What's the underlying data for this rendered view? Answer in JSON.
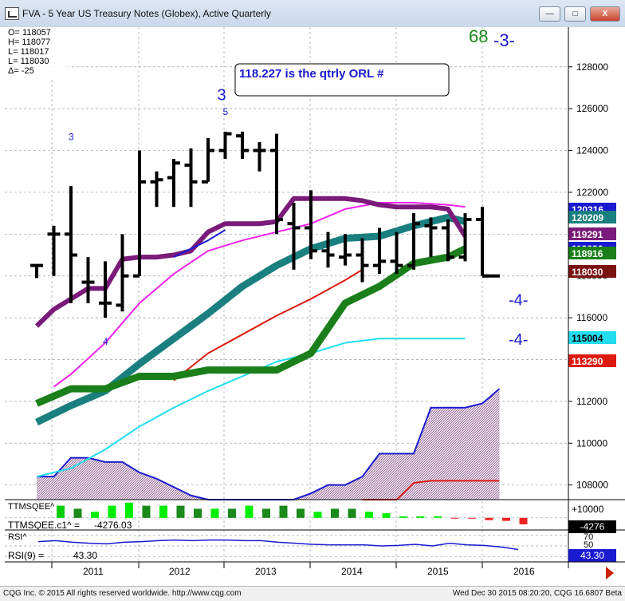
{
  "window": {
    "title": "FVA - 5 Year US Treasury Notes (Globex), Active Quarterly",
    "minimize_label": "—",
    "maximize_label": "□",
    "close_label": "X"
  },
  "status_bar": {
    "copyright": "CQG Inc. © 2015 All rights reserved worldwide. http://www.cqg.com",
    "timestamp": "Wed Dec 30 2015 08:20:20, CQG 16.6807 Beta"
  },
  "chart_data": [
    {
      "type": "ohlc",
      "panel": "price",
      "info_box": [
        "O= 118057",
        "H= 118077",
        "L= 118017",
        "L= 118030",
        "Δ=   -25"
      ],
      "annotation_box": "118.227 is the qtrly ORL #",
      "corner_labels": {
        "green": "68",
        "blue": "-3-"
      },
      "x_labels": [
        "2011",
        "2012",
        "2013",
        "2014",
        "2015",
        "2016"
      ],
      "y_ticks": [
        "128000",
        "126000",
        "124000",
        "122000",
        "120000",
        "118000",
        "116000",
        "114000",
        "112000",
        "110000",
        "108000"
      ],
      "ylim": [
        107300,
        129900
      ],
      "bars": [
        {
          "t": 0,
          "o": 118500,
          "h": 118500,
          "l": 117900,
          "c": 118500
        },
        {
          "t": 1,
          "o": 120000,
          "h": 120400,
          "l": 118000,
          "c": 120000
        },
        {
          "t": 2,
          "o": 120000,
          "h": 122300,
          "l": 116700,
          "c": 119000
        },
        {
          "t": 3,
          "o": 117700,
          "h": 118900,
          "l": 116700,
          "c": 117700
        },
        {
          "t": 4,
          "o": 116700,
          "h": 118700,
          "l": 116000,
          "c": 116700
        },
        {
          "t": 5,
          "o": 116600,
          "h": 120000,
          "l": 116300,
          "c": 118000
        },
        {
          "t": 6,
          "o": 118000,
          "h": 124000,
          "l": 118000,
          "c": 122500
        },
        {
          "t": 7,
          "o": 122500,
          "h": 123000,
          "l": 121300,
          "c": 122600
        },
        {
          "t": 8,
          "o": 122700,
          "h": 123600,
          "l": 121300,
          "c": 123400
        },
        {
          "t": 9,
          "o": 123300,
          "h": 124100,
          "l": 121300,
          "c": 122500
        },
        {
          "t": 10,
          "o": 122500,
          "h": 124600,
          "l": 122500,
          "c": 124000
        },
        {
          "t": 11,
          "o": 124000,
          "h": 124900,
          "l": 123600,
          "c": 124800
        },
        {
          "t": 12,
          "o": 124700,
          "h": 124900,
          "l": 123600,
          "c": 124000
        },
        {
          "t": 13,
          "o": 124000,
          "h": 124400,
          "l": 123000,
          "c": 124000
        },
        {
          "t": 14,
          "o": 124000,
          "h": 124800,
          "l": 120000,
          "c": 120700
        },
        {
          "t": 15,
          "o": 120500,
          "h": 121500,
          "l": 118300,
          "c": 120300
        },
        {
          "t": 16,
          "o": 120300,
          "h": 122100,
          "l": 118800,
          "c": 119200
        },
        {
          "t": 17,
          "o": 119200,
          "h": 120100,
          "l": 118400,
          "c": 119000
        },
        {
          "t": 18,
          "o": 118900,
          "h": 120000,
          "l": 118500,
          "c": 119000
        },
        {
          "t": 19,
          "o": 119000,
          "h": 119800,
          "l": 117700,
          "c": 118500
        },
        {
          "t": 20,
          "o": 118500,
          "h": 120300,
          "l": 118100,
          "c": 118700
        },
        {
          "t": 21,
          "o": 118700,
          "h": 120100,
          "l": 118100,
          "c": 118500
        },
        {
          "t": 22,
          "o": 118500,
          "h": 121000,
          "l": 118300,
          "c": 120500
        },
        {
          "t": 23,
          "o": 120400,
          "h": 120800,
          "l": 118900,
          "c": 120300
        },
        {
          "t": 24,
          "o": 120300,
          "h": 120700,
          "l": 118700,
          "c": 118900
        },
        {
          "t": 25,
          "o": 118900,
          "h": 121000,
          "l": 118700,
          "c": 120700
        },
        {
          "t": 26,
          "o": 120700,
          "h": 121300,
          "l": 118000,
          "c": 118000
        }
      ],
      "lines": [
        {
          "name": "purple",
          "color": "#7a1a7a",
          "width": 6,
          "t": [
            0,
            1,
            2,
            3,
            4,
            5,
            6,
            7,
            8,
            9,
            10,
            11,
            12,
            13,
            14,
            15,
            16,
            17,
            18,
            19,
            20,
            21,
            22,
            23,
            24,
            25
          ],
          "v": [
            115600,
            116400,
            116900,
            117400,
            117400,
            118800,
            118900,
            118900,
            119000,
            119200,
            120100,
            120500,
            120500,
            120500,
            120600,
            121700,
            121700,
            121700,
            121700,
            121600,
            121400,
            121300,
            121300,
            121300,
            121200,
            119900
          ]
        },
        {
          "name": "teal",
          "color": "#1a7f7f",
          "width": 9,
          "t": [
            0,
            2,
            4,
            6,
            8,
            10,
            12,
            14,
            16,
            18,
            20,
            22,
            24,
            25
          ],
          "v": [
            111000,
            111800,
            112500,
            113800,
            115000,
            116200,
            117500,
            118500,
            119300,
            119800,
            119900,
            120400,
            120800,
            120600
          ]
        },
        {
          "name": "green",
          "color": "#1a7f1a",
          "width": 9,
          "t": [
            0,
            2,
            4,
            6,
            8,
            10,
            12,
            14,
            16,
            18,
            20,
            22,
            24,
            25
          ],
          "v": [
            111900,
            112600,
            112600,
            113200,
            113200,
            113500,
            113500,
            113500,
            114300,
            116700,
            117500,
            118600,
            118900,
            119300
          ]
        },
        {
          "name": "magenta",
          "color": "#ee22ee",
          "width": 2,
          "t": [
            1,
            2,
            4,
            6,
            8,
            10,
            12,
            14,
            16,
            18,
            20,
            22,
            24,
            25
          ],
          "v": [
            112700,
            113300,
            114800,
            116700,
            118100,
            119200,
            119700,
            120100,
            120500,
            121200,
            121500,
            121500,
            121400,
            121300
          ]
        },
        {
          "name": "red",
          "color": "#dd1a10",
          "width": 2,
          "t": [
            8,
            10,
            12,
            14,
            16,
            18,
            19
          ],
          "v": [
            113000,
            114300,
            115200,
            116100,
            116900,
            117800,
            118300
          ]
        },
        {
          "name": "blue",
          "color": "#1a1ad0",
          "width": 2,
          "t": [
            8,
            10,
            11
          ],
          "v": [
            118900,
            119700,
            120200
          ]
        },
        {
          "name": "cyan",
          "color": "#22ddee",
          "width": 2,
          "t": [
            0,
            2,
            4,
            6,
            8,
            10,
            12,
            14,
            16,
            18,
            20,
            22,
            24,
            25
          ],
          "v": [
            108400,
            108800,
            109700,
            110800,
            111700,
            112500,
            113200,
            113900,
            114300,
            114800,
            115000,
            115000,
            115000,
            115000
          ]
        }
      ],
      "price_labels": [
        {
          "text": "120316",
          "value": 120316,
          "bg": "#1a1ad0",
          "fg": "#ffffff"
        },
        {
          "text": "120209",
          "value": 120209,
          "bg": "#1a7f7f",
          "fg": "#ffffff"
        },
        {
          "text": "119291",
          "value": 119291,
          "bg": "#7a1a7a",
          "fg": "#ffffff"
        },
        {
          "text": "119096",
          "value": 119096,
          "bg": "#1a1ad0",
          "fg": "#ffffff"
        },
        {
          "text": "118916",
          "value": 118916,
          "bg": "#1a7f1a",
          "fg": "#ffffff"
        },
        {
          "text": "118030",
          "value": 118030,
          "bg": "#7a1212",
          "fg": "#ffffff"
        },
        {
          "text": "115004",
          "value": 115004,
          "bg": "#22ddee",
          "fg": "#000000"
        },
        {
          "text": "113290",
          "value": 113290,
          "bg": "#dd1a10",
          "fg": "#ffffff"
        }
      ],
      "annotations": [
        {
          "text": "3",
          "t": 2,
          "v": 124500,
          "size": 12
        },
        {
          "text": "4",
          "t": 4,
          "v": 114700,
          "size": 12
        },
        {
          "text": "3",
          "t": 11,
          "v": 126400,
          "size": 20
        },
        {
          "text": "5",
          "t": 11,
          "v": 125700,
          "size": 12
        },
        {
          "text": "-4-",
          "t": 28,
          "v": 116600,
          "size": 20
        },
        {
          "text": "-4-",
          "t": 28,
          "v": 114700,
          "size": 20
        }
      ],
      "overlay": {
        "name": "purple band",
        "color": "#1a1ad0",
        "t": [
          0,
          1,
          2,
          3,
          4,
          5,
          6,
          7,
          8,
          9,
          10,
          11,
          12,
          13,
          14,
          15,
          16,
          17,
          18,
          19,
          20,
          21,
          22,
          23,
          24,
          25,
          26,
          27
        ],
        "v": [
          108400,
          108400,
          109300,
          109300,
          109100,
          109100,
          108600,
          108300,
          107900,
          107500,
          107300,
          107300,
          107300,
          107300,
          107300,
          107300,
          107600,
          108000,
          108000,
          108400,
          109500,
          109500,
          109500,
          111700,
          111700,
          111700,
          111900,
          112600
        ]
      },
      "baseline": {
        "name": "red base",
        "color": "#dd1a10",
        "t": [
          19,
          20,
          21,
          22,
          23,
          24,
          25,
          26,
          27
        ],
        "v": [
          107300,
          107300,
          107300,
          108100,
          108200,
          108200,
          108200,
          108200,
          108200
        ]
      }
    },
    {
      "type": "bar",
      "panel": "TTMSQEE",
      "label": "TTMSQEE^",
      "label2": "TTMSQEE.c1^ =",
      "value_text": "-4276.03",
      "y_ticks": [
        "+10000",
        "0"
      ],
      "right_label": "-4276",
      "ylim": [
        -8000,
        12000
      ],
      "values": [
        8000,
        6000,
        4000,
        8000,
        10000,
        8000,
        8000,
        8000,
        6000,
        6000,
        6000,
        8000,
        6000,
        8000,
        6000,
        4000,
        6000,
        6000,
        4000,
        3000,
        1000,
        1000,
        1000,
        -500,
        -500,
        -1500,
        -2000,
        -4276
      ],
      "colors": [
        "#00cc00",
        "#1a8a1a",
        "#00ee00",
        "#00ee00",
        "#00ee00",
        "#1a8a1a",
        "#00ee00",
        "#1a8a1a",
        "#1a8a1a",
        "#00ee00",
        "#1a8a1a",
        "#00ee00",
        "#1a8a1a",
        "#1a8a1a",
        "#1a8a1a",
        "#00ee00",
        "#1a8a1a",
        "#1a8a1a",
        "#00ee00",
        "#00ee00",
        "#00ee00",
        "#00ee00",
        "#00ee00",
        "#ee2222",
        "#ee2222",
        "#ee2222",
        "#ee2222",
        "#ee2222"
      ]
    },
    {
      "type": "line",
      "panel": "RSI",
      "label": "RSI^",
      "label2": "RSI(9) =",
      "value_text": "43.30",
      "y_ticks": [
        "70",
        "50",
        "30"
      ],
      "right_label": "43.30",
      "ylim": [
        20,
        80
      ],
      "values": [
        58,
        60,
        57,
        55,
        54,
        57,
        58,
        60,
        61,
        60,
        61,
        61,
        60,
        60,
        57,
        55,
        53,
        52,
        52,
        52,
        50,
        51,
        53,
        50,
        55,
        52,
        51,
        48,
        43.3
      ],
      "color": "#1a1ad0"
    }
  ]
}
